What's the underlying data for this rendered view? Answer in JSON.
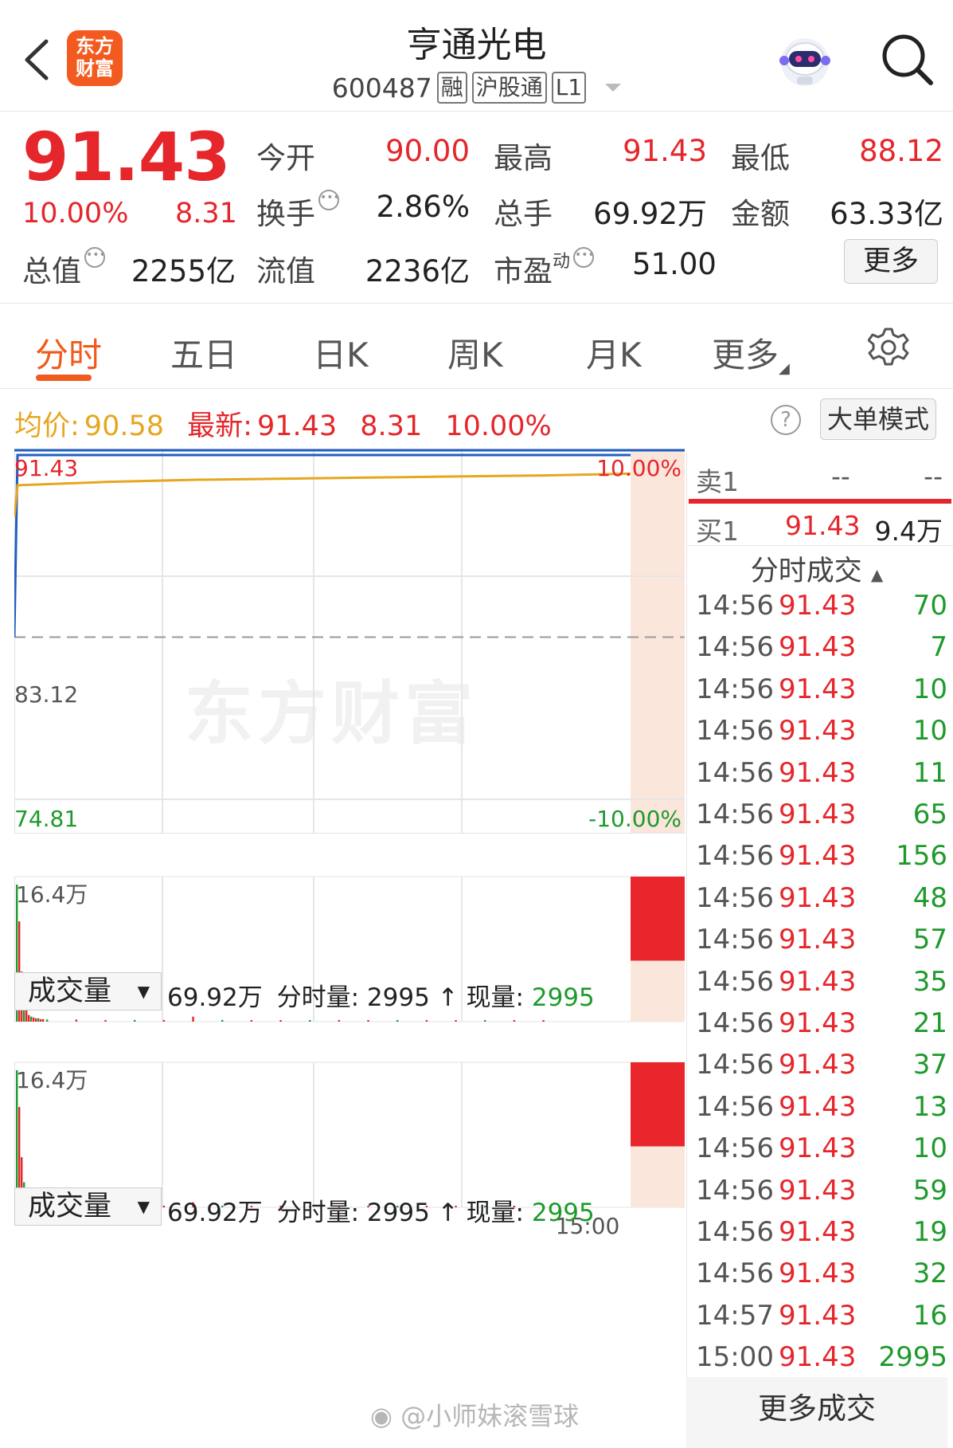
{
  "header": {
    "back_icon": "chevron-left-icon",
    "logo_text": "东方\n财富",
    "title": "亨通光电",
    "code": "600487",
    "tags": [
      "融",
      "沪股通",
      "L1"
    ],
    "assistant_icon": "robot-avatar-icon",
    "search_icon": "search-icon"
  },
  "quote": {
    "price": "91.43",
    "change_pct": "10.00%",
    "change": "8.31",
    "open_label": "今开",
    "open": "90.00",
    "high_label": "最高",
    "high": "91.43",
    "low_label": "最低",
    "low": "88.12",
    "turnover_label": "换手",
    "turnover": "2.86%",
    "volume_label": "总手",
    "volume": "69.92万",
    "amount_label": "金额",
    "amount": "63.33亿",
    "mktcap_label": "总值",
    "mktcap": "2255亿",
    "float_label": "流值",
    "float": "2236亿",
    "pe_label": "市盈",
    "pe_sup": "动",
    "pe": "51.00",
    "more_label": "更多"
  },
  "tabs": [
    "分时",
    "五日",
    "日K",
    "周K",
    "月K",
    "更多"
  ],
  "infobar": {
    "avg_label": "均价:",
    "avg": "90.58",
    "latest_label": "最新:",
    "latest": "91.43",
    "latest_chg": "8.31",
    "latest_pct": "10.00%",
    "help_icon": "question-icon",
    "bigorder_label": "大单模式"
  },
  "chart": {
    "watermark": "东方财富",
    "vol_selector_label": "成交量",
    "vol_total": "69.92万",
    "vol_min_label": "分时量:",
    "vol_min": "2995",
    "vol_now_label": "现量:",
    "vol_now": "2995",
    "vol_max_label": "16.4万",
    "time_end_label": "15:00"
  },
  "chart_data": {
    "type": "line",
    "title": "",
    "ylim": [
      74.81,
      91.43
    ],
    "y_tick_labels": [
      "91.43",
      "83.12",
      "74.81"
    ],
    "right_tick_labels": [
      "10.00%",
      "-10.00%"
    ],
    "reference": 83.12,
    "series": [
      {
        "name": "",
        "color": "#1f5fbf",
        "values": [
          83.12,
          91.43,
          91.43,
          91.43,
          91.43,
          91.43,
          91.43,
          91.43,
          91.43
        ]
      },
      {
        "name": "",
        "color": "#e6a61e",
        "values": [
          88.6,
          90.05,
          90.2,
          90.3,
          90.35,
          90.4,
          90.45,
          90.5,
          90.58
        ]
      }
    ],
    "volume": {
      "ylim": [
        0,
        164000
      ],
      "values": [
        164000,
        120000,
        60000,
        30000,
        15000,
        8000,
        6000,
        5000,
        4000,
        4000,
        3000,
        3000,
        2500,
        2500,
        2000,
        2000,
        2000,
        6000,
        2000,
        1500,
        1500,
        1500,
        1500,
        1500,
        1200,
        1200,
        1200,
        1000,
        1000,
        1000,
        2995
      ]
    }
  },
  "orderbook": {
    "sell_label": "卖1",
    "sell_price": "--",
    "sell_vol": "--",
    "buy_label": "买1",
    "buy_price": "91.43",
    "buy_vol": "9.4万"
  },
  "trades_title": "分时成交",
  "trades": [
    {
      "t": "14:56",
      "p": "91.43",
      "v": "70"
    },
    {
      "t": "14:56",
      "p": "91.43",
      "v": "7"
    },
    {
      "t": "14:56",
      "p": "91.43",
      "v": "10"
    },
    {
      "t": "14:56",
      "p": "91.43",
      "v": "10"
    },
    {
      "t": "14:56",
      "p": "91.43",
      "v": "11"
    },
    {
      "t": "14:56",
      "p": "91.43",
      "v": "65"
    },
    {
      "t": "14:56",
      "p": "91.43",
      "v": "156"
    },
    {
      "t": "14:56",
      "p": "91.43",
      "v": "48"
    },
    {
      "t": "14:56",
      "p": "91.43",
      "v": "57"
    },
    {
      "t": "14:56",
      "p": "91.43",
      "v": "35"
    },
    {
      "t": "14:56",
      "p": "91.43",
      "v": "21"
    },
    {
      "t": "14:56",
      "p": "91.43",
      "v": "37"
    },
    {
      "t": "14:56",
      "p": "91.43",
      "v": "13"
    },
    {
      "t": "14:56",
      "p": "91.43",
      "v": "10"
    },
    {
      "t": "14:56",
      "p": "91.43",
      "v": "59"
    },
    {
      "t": "14:56",
      "p": "91.43",
      "v": "19"
    },
    {
      "t": "14:56",
      "p": "91.43",
      "v": "32"
    },
    {
      "t": "14:57",
      "p": "91.43",
      "v": "16"
    },
    {
      "t": "15:00",
      "p": "91.43",
      "v": "2995"
    }
  ],
  "more_trades_label": "更多成交",
  "footer_watermark": "@小师妹滚雪球"
}
